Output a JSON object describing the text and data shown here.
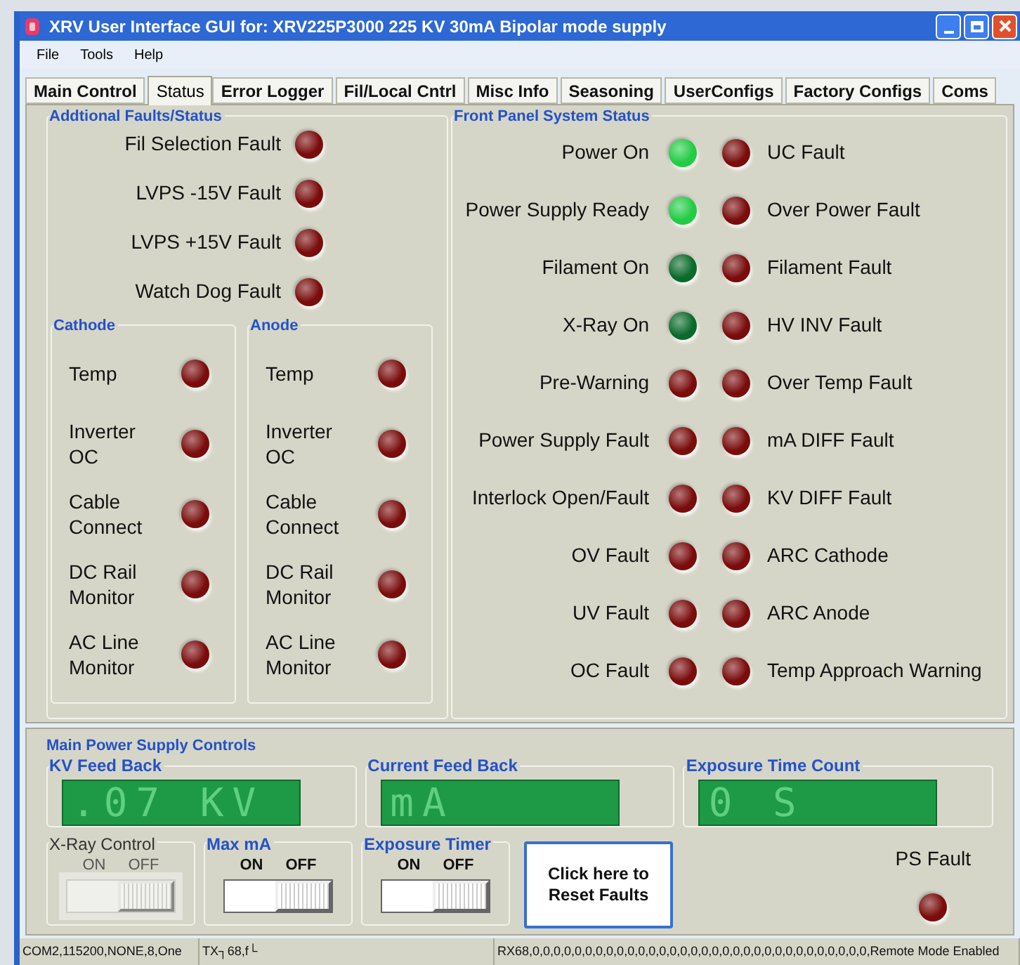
{
  "window": {
    "title": "XRV User Interface GUI for: XRV225P3000 225 KV 30mA Bipolar mode supply"
  },
  "menu": [
    "File",
    "Tools",
    "Help"
  ],
  "tabs": [
    {
      "label": "Main Control",
      "selected": false
    },
    {
      "label": "Status",
      "selected": true
    },
    {
      "label": "Error Logger",
      "selected": false
    },
    {
      "label": "Fil/Local Cntrl",
      "selected": false
    },
    {
      "label": "Misc Info",
      "selected": false
    },
    {
      "label": "Seasoning",
      "selected": false
    },
    {
      "label": "UserConfigs",
      "selected": false
    },
    {
      "label": "Factory Configs",
      "selected": false
    },
    {
      "label": "Coms",
      "selected": false
    }
  ],
  "additional_faults": {
    "title": "Addtional Faults/Status",
    "items": [
      {
        "label": "Fil Selection Fault",
        "color": "#7a0c0c"
      },
      {
        "label": "LVPS -15V Fault",
        "color": "#7a0c0c"
      },
      {
        "label": "LVPS +15V Fault",
        "color": "#7a0c0c"
      },
      {
        "label": "Watch Dog Fault",
        "color": "#7a0c0c"
      }
    ],
    "groups": [
      {
        "title": "Cathode",
        "items": [
          {
            "label": "Temp",
            "color": "#7a0c0c"
          },
          {
            "label": "Inverter OC",
            "color": "#7a0c0c"
          },
          {
            "label": "Cable Connect",
            "color": "#7a0c0c"
          },
          {
            "label": "DC Rail Monitor",
            "color": "#7a0c0c"
          },
          {
            "label": "AC Line Monitor",
            "color": "#7a0c0c"
          }
        ]
      },
      {
        "title": "Anode",
        "items": [
          {
            "label": "Temp",
            "color": "#7a0c0c"
          },
          {
            "label": "Inverter OC",
            "color": "#7a0c0c"
          },
          {
            "label": "Cable Connect",
            "color": "#7a0c0c"
          },
          {
            "label": "DC Rail Monitor",
            "color": "#7a0c0c"
          },
          {
            "label": "AC Line Monitor",
            "color": "#7a0c0c"
          }
        ]
      }
    ]
  },
  "front_panel": {
    "title": "Front Panel System Status",
    "rows": [
      {
        "left": {
          "label": "Power On",
          "color": "#22cc44"
        },
        "right": {
          "label": "UC Fault",
          "color": "#7a0c0c"
        }
      },
      {
        "left": {
          "label": "Power Supply Ready",
          "color": "#22cc44"
        },
        "right": {
          "label": "Over Power Fault",
          "color": "#7a0c0c"
        }
      },
      {
        "left": {
          "label": "Filament On",
          "color": "#0b6a2c"
        },
        "right": {
          "label": "Filament Fault",
          "color": "#7a0c0c"
        }
      },
      {
        "left": {
          "label": "X-Ray On",
          "color": "#0b6a2c"
        },
        "right": {
          "label": "HV INV Fault",
          "color": "#7a0c0c"
        }
      },
      {
        "left": {
          "label": "Pre-Warning",
          "color": "#7a0c0c"
        },
        "right": {
          "label": "Over Temp Fault",
          "color": "#7a0c0c"
        }
      },
      {
        "left": {
          "label": "Power Supply Fault",
          "color": "#7a0c0c"
        },
        "right": {
          "label": "mA DIFF Fault",
          "color": "#7a0c0c"
        }
      },
      {
        "left": {
          "label": "Interlock Open/Fault",
          "color": "#7a0c0c"
        },
        "right": {
          "label": "KV DIFF Fault",
          "color": "#7a0c0c"
        }
      },
      {
        "left": {
          "label": "OV Fault",
          "color": "#7a0c0c"
        },
        "right": {
          "label": "ARC Cathode",
          "color": "#7a0c0c"
        }
      },
      {
        "left": {
          "label": "UV Fault",
          "color": "#7a0c0c"
        },
        "right": {
          "label": "ARC Anode",
          "color": "#7a0c0c"
        }
      },
      {
        "left": {
          "label": "OC Fault",
          "color": "#7a0c0c"
        },
        "right": {
          "label": "Temp Approach Warning",
          "color": "#7a0c0c"
        }
      }
    ]
  },
  "power_supply_controls": {
    "title": "Main Power Supply Controls",
    "displays": [
      {
        "label": "KV Feed Back",
        "value": ".07 KV"
      },
      {
        "label": "Current Feed Back",
        "value": "mA"
      },
      {
        "label": "Exposure Time Count",
        "value": "0 S"
      }
    ],
    "toggles": [
      {
        "label": "X-Ray Control",
        "on_label": "ON",
        "off_label": "OFF",
        "on": false,
        "disabled": true
      },
      {
        "label": "Max mA",
        "on_label": "ON",
        "off_label": "OFF",
        "on": false,
        "disabled": false
      },
      {
        "label": "Exposure Timer",
        "on_label": "ON",
        "off_label": "OFF",
        "on": false,
        "disabled": false
      }
    ],
    "reset_button": "Click here to Reset Faults",
    "ps_fault": {
      "label": "PS Fault",
      "color": "#7a0c0c"
    }
  },
  "status_bar": [
    "COM2,115200,NONE,8,One",
    "TX┐68,f└",
    "RX68,0,0,0,0,0,0,0,0,0,0,0,0,0,0,0,0,0,0,0,0,0,0,0,0,0,0,0,0,0,0,0,0,Remote Mode Enabled"
  ]
}
